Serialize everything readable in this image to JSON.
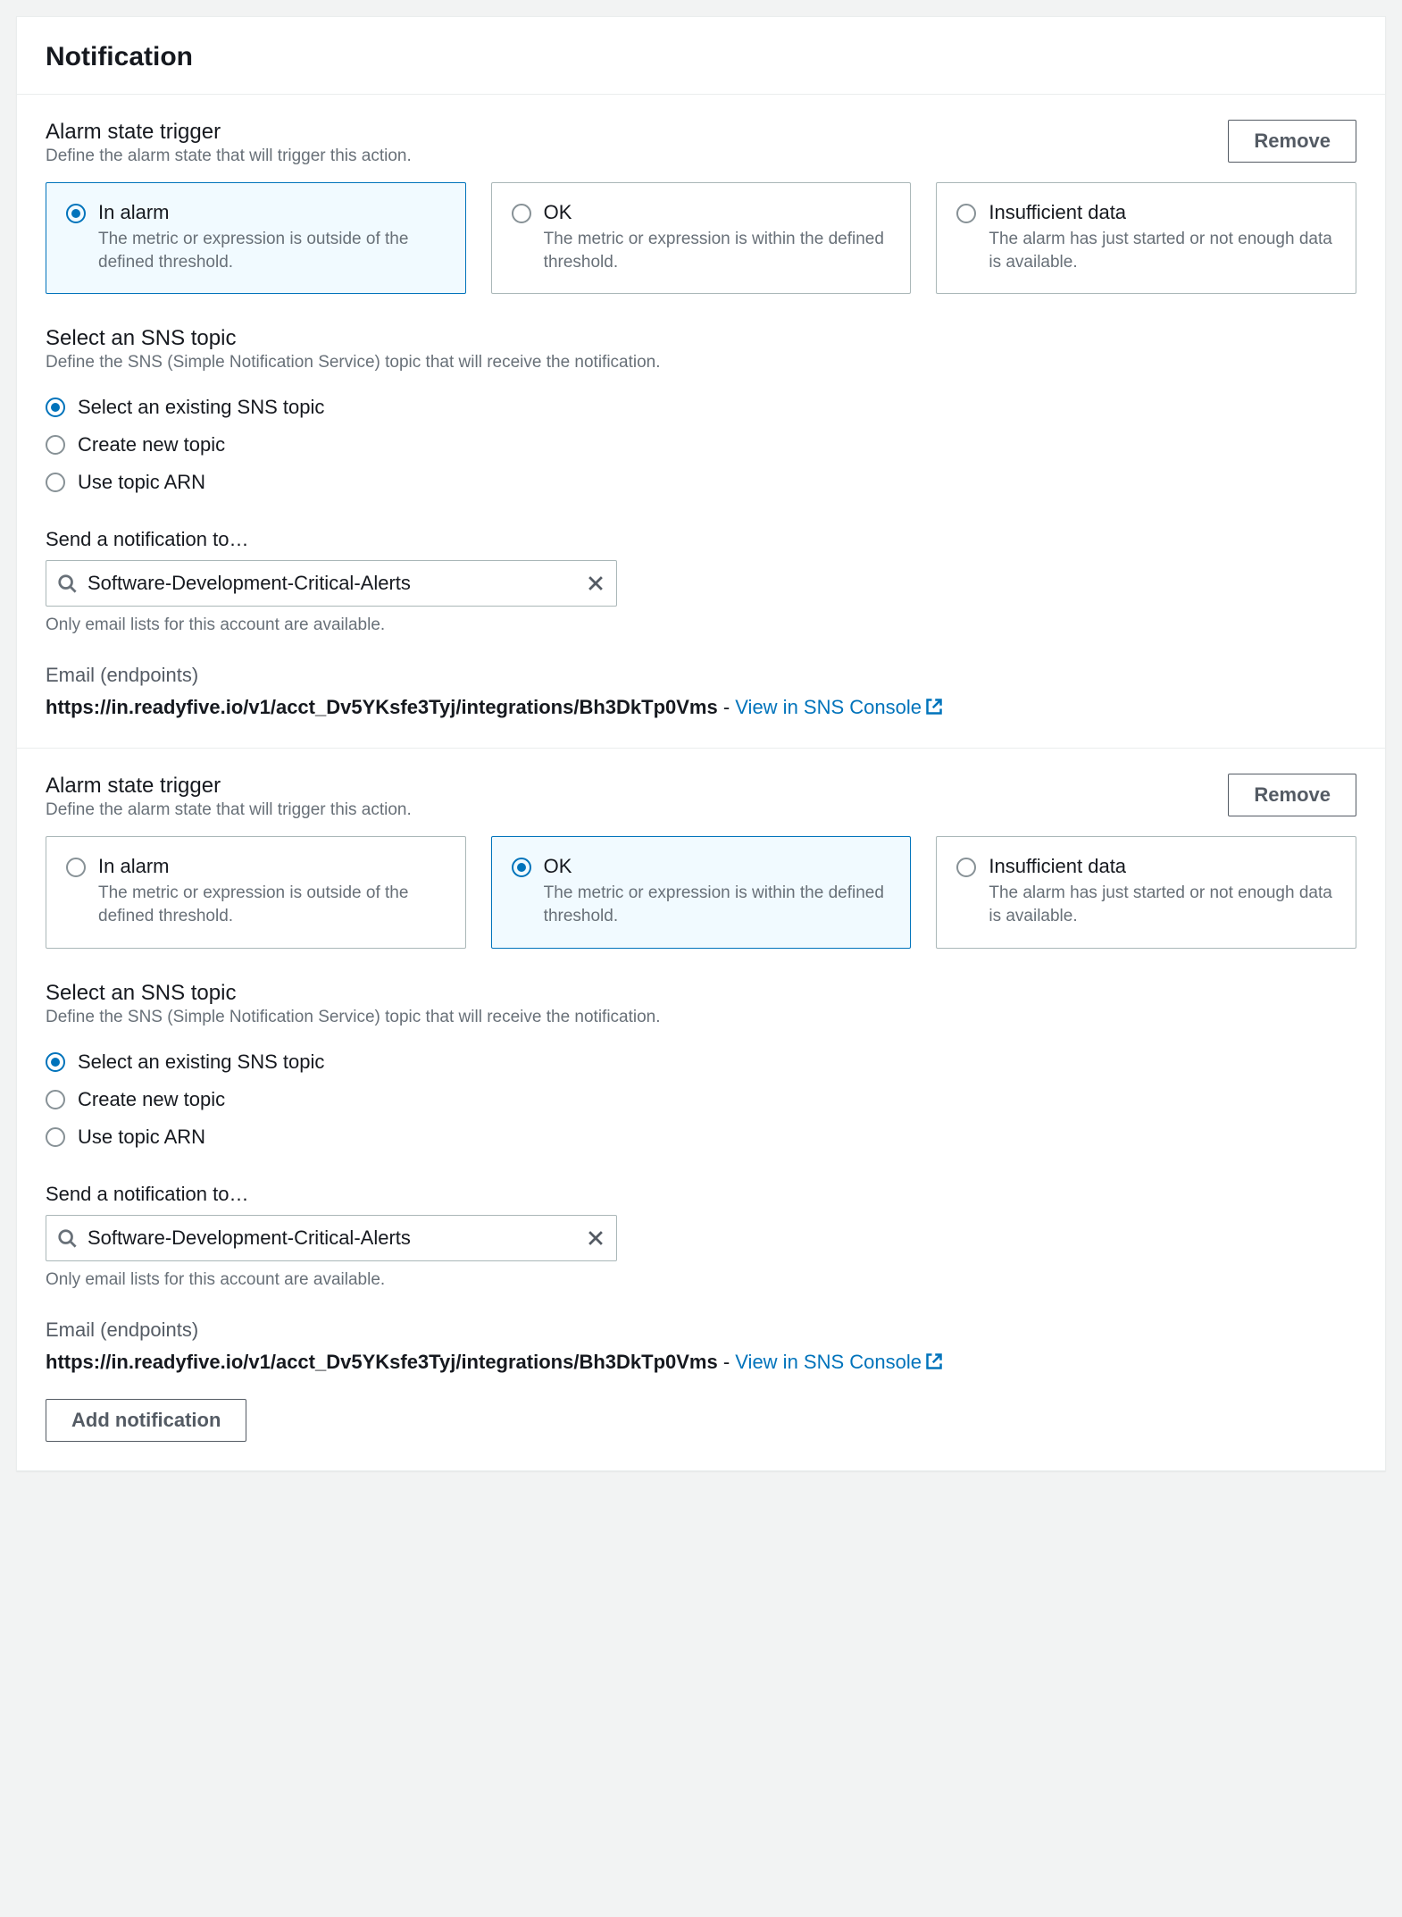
{
  "panel": {
    "title": "Notification"
  },
  "labels": {
    "alarm_state_heading": "Alarm state trigger",
    "alarm_state_desc": "Define the alarm state that will trigger this action.",
    "remove": "Remove",
    "sns_heading": "Select an SNS topic",
    "sns_desc": "Define the SNS (Simple Notification Service) topic that will receive the notification.",
    "send_to_label": "Send a notification to…",
    "send_to_helper": "Only email lists for this account are available.",
    "endpoints_title": "Email (endpoints)",
    "view_in_sns": "View in SNS Console",
    "dash": " - ",
    "add_notification": "Add notification"
  },
  "alarm_state_options": [
    {
      "title": "In alarm",
      "desc": "The metric or expression is outside of the defined threshold."
    },
    {
      "title": "OK",
      "desc": "The metric or expression is within the defined threshold."
    },
    {
      "title": "Insufficient data",
      "desc": "The alarm has just started or not enough data is available."
    }
  ],
  "sns_topic_options": [
    "Select an existing SNS topic",
    "Create new topic",
    "Use topic ARN"
  ],
  "blocks": [
    {
      "alarm_state_selected_index": 0,
      "sns_option_selected_index": 0,
      "send_to_value": "Software-Development-Critical-Alerts",
      "endpoint_url": "https://in.readyfive.io/v1/acct_Dv5YKsfe3Tyj/integrations/Bh3DkTp0Vms"
    },
    {
      "alarm_state_selected_index": 1,
      "sns_option_selected_index": 0,
      "send_to_value": "Software-Development-Critical-Alerts",
      "endpoint_url": "https://in.readyfive.io/v1/acct_Dv5YKsfe3Tyj/integrations/Bh3DkTp0Vms"
    }
  ]
}
